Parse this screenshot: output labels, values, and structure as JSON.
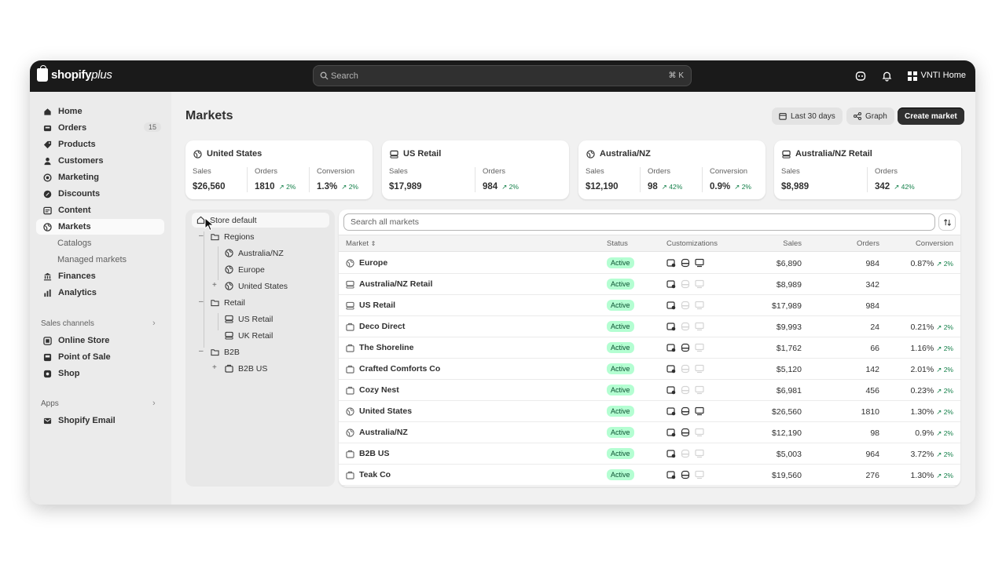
{
  "topbar": {
    "logo_main": "shopify",
    "logo_plus": "plus",
    "search_placeholder": "Search",
    "search_shortcut": "⌘ K",
    "store_name": "VNTI Home"
  },
  "sidebar": {
    "items": [
      {
        "label": "Home",
        "icon": "home-icon"
      },
      {
        "label": "Orders",
        "icon": "inbox-icon",
        "badge": "15"
      },
      {
        "label": "Products",
        "icon": "tag-icon"
      },
      {
        "label": "Customers",
        "icon": "person-icon"
      },
      {
        "label": "Marketing",
        "icon": "target-icon"
      },
      {
        "label": "Discounts",
        "icon": "discount-icon"
      },
      {
        "label": "Content",
        "icon": "content-icon"
      },
      {
        "label": "Markets",
        "icon": "globe-icon",
        "active": true
      }
    ],
    "market_subitems": [
      "Catalogs",
      "Managed markets"
    ],
    "items2": [
      {
        "label": "Finances",
        "icon": "bank-icon"
      },
      {
        "label": "Analytics",
        "icon": "chart-icon"
      }
    ],
    "sales_channels_title": "Sales channels",
    "channels": [
      {
        "label": "Online Store",
        "icon": "store-icon"
      },
      {
        "label": "Point of Sale",
        "icon": "pos-icon"
      },
      {
        "label": "Shop",
        "icon": "shop-icon"
      }
    ],
    "apps_title": "Apps",
    "apps": [
      {
        "label": "Shopify Email",
        "icon": "email-icon"
      }
    ]
  },
  "page": {
    "title": "Markets",
    "date_button": "Last 30 days",
    "graph_button": "Graph",
    "create_button": "Create market"
  },
  "cards": [
    {
      "title": "United States",
      "icon": "globe-icon",
      "metrics": [
        {
          "label": "Sales",
          "value": "$26,560",
          "trend": ""
        },
        {
          "label": "Orders",
          "value": "1810",
          "trend": "↗ 2%"
        },
        {
          "label": "Conversion",
          "value": "1.3%",
          "trend": "↗ 2%"
        }
      ]
    },
    {
      "title": "US Retail",
      "icon": "pos-icon",
      "metrics": [
        {
          "label": "Sales",
          "value": "$17,989",
          "trend": ""
        },
        {
          "label": "Orders",
          "value": "984",
          "trend": "↗ 2%"
        }
      ]
    },
    {
      "title": "Australia/NZ",
      "icon": "globe-icon",
      "metrics": [
        {
          "label": "Sales",
          "value": "$12,190",
          "trend": ""
        },
        {
          "label": "Orders",
          "value": "98",
          "trend": "↗ 42%"
        },
        {
          "label": "Conversion",
          "value": "0.9%",
          "trend": "↗ 2%"
        }
      ]
    },
    {
      "title": "Australia/NZ Retail",
      "icon": "pos-icon",
      "metrics": [
        {
          "label": "Sales",
          "value": "$8,989",
          "trend": ""
        },
        {
          "label": "Orders",
          "value": "342",
          "trend": "↗ 42%"
        }
      ]
    }
  ],
  "tree": {
    "root": "Store default",
    "regions": "Regions",
    "region_items": [
      "Australia/NZ",
      "Europe",
      "United States"
    ],
    "retail": "Retail",
    "retail_items": [
      "US Retail",
      "UK Retail"
    ],
    "b2b": "B2B",
    "b2b_items": [
      "B2B US"
    ],
    "toggle_minus": "–",
    "toggle_plus": "+"
  },
  "table": {
    "search_placeholder": "Search all markets",
    "headers": {
      "market": "Market",
      "status": "Status",
      "customizations": "Customizations",
      "sales": "Sales",
      "orders": "Orders",
      "conversion": "Conversion"
    },
    "rows": [
      {
        "name": "Europe",
        "icon": "globe",
        "status": "Active",
        "cust": [
          1,
          1,
          1
        ],
        "sales": "$6,890",
        "orders": "984",
        "conv": "0.87%",
        "trend": "↗ 2%"
      },
      {
        "name": "Australia/NZ Retail",
        "icon": "pos",
        "status": "Active",
        "cust": [
          1,
          0,
          0
        ],
        "sales": "$8,989",
        "orders": "342",
        "conv": "",
        "trend": ""
      },
      {
        "name": "US Retail",
        "icon": "pos",
        "status": "Active",
        "cust": [
          1,
          0,
          0
        ],
        "sales": "$17,989",
        "orders": "984",
        "conv": "",
        "trend": ""
      },
      {
        "name": "Deco Direct",
        "icon": "b2b",
        "status": "Active",
        "cust": [
          1,
          0,
          0
        ],
        "sales": "$9,993",
        "orders": "24",
        "conv": "0.21%",
        "trend": "↗ 2%"
      },
      {
        "name": "The Shoreline",
        "icon": "b2b",
        "status": "Active",
        "cust": [
          1,
          1,
          0
        ],
        "sales": "$1,762",
        "orders": "66",
        "conv": "1.16%",
        "trend": "↗ 2%"
      },
      {
        "name": "Crafted Comforts Co",
        "icon": "b2b",
        "status": "Active",
        "cust": [
          1,
          0,
          0
        ],
        "sales": "$5,120",
        "orders": "142",
        "conv": "2.01%",
        "trend": "↗ 2%"
      },
      {
        "name": "Cozy Nest",
        "icon": "b2b",
        "status": "Active",
        "cust": [
          1,
          0,
          0
        ],
        "sales": "$6,981",
        "orders": "456",
        "conv": "0.23%",
        "trend": "↗ 2%"
      },
      {
        "name": "United States",
        "icon": "globe",
        "status": "Active",
        "cust": [
          1,
          1,
          1
        ],
        "sales": "$26,560",
        "orders": "1810",
        "conv": "1.30%",
        "trend": "↗ 2%"
      },
      {
        "name": "Australia/NZ",
        "icon": "globe",
        "status": "Active",
        "cust": [
          1,
          1,
          0
        ],
        "sales": "$12,190",
        "orders": "98",
        "conv": "0.9%",
        "trend": "↗ 2%"
      },
      {
        "name": "B2B US",
        "icon": "b2b",
        "status": "Active",
        "cust": [
          1,
          0,
          0
        ],
        "sales": "$5,003",
        "orders": "964",
        "conv": "3.72%",
        "trend": "↗ 2%"
      },
      {
        "name": "Teak Co",
        "icon": "b2b",
        "status": "Active",
        "cust": [
          1,
          1,
          0
        ],
        "sales": "$19,560",
        "orders": "276",
        "conv": "1.30%",
        "trend": "↗ 2%"
      }
    ]
  },
  "colors": {
    "topbar": "#1a1a1a",
    "active_badge": "#b4fed2",
    "trend_green": "#14804a"
  }
}
